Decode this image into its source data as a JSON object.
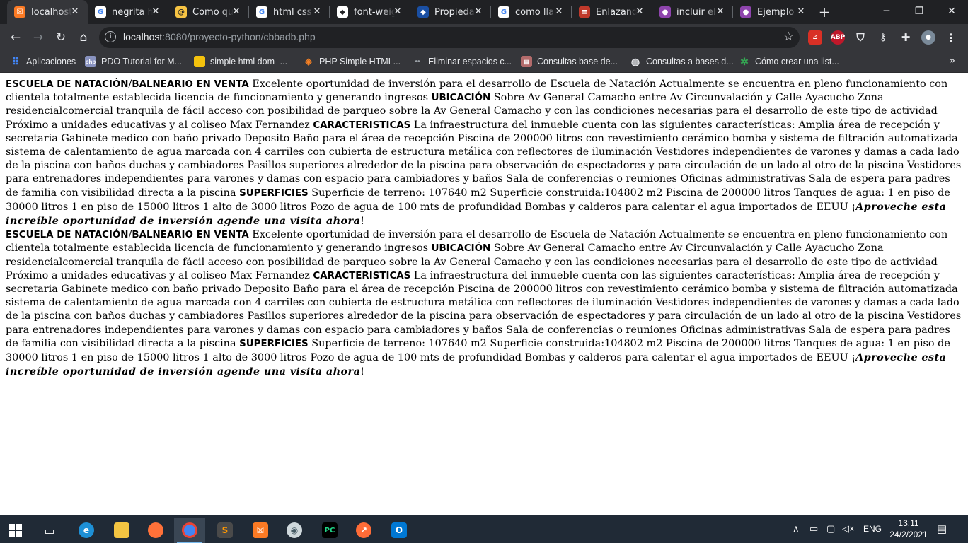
{
  "browser": {
    "tabs": [
      {
        "title": "localhost",
        "favicon": "xampp-icon",
        "color": "#fb7a24",
        "active": true
      },
      {
        "title": "negrita h",
        "favicon": "google-icon",
        "color": "#4285f4",
        "active": false
      },
      {
        "title": "Como qu",
        "favicon": "site-icon",
        "color": "#f6c343",
        "active": false
      },
      {
        "title": "html css",
        "favicon": "google-icon",
        "color": "#4285f4",
        "active": false
      },
      {
        "title": "font-weig",
        "favicon": "site-icon",
        "color": "#ffffff",
        "active": false
      },
      {
        "title": "Propieda",
        "favicon": "site-icon",
        "color": "#1a4fa3",
        "active": false
      },
      {
        "title": "como llar",
        "favicon": "google-icon",
        "color": "#4285f4",
        "active": false
      },
      {
        "title": "Enlazand",
        "favicon": "site-icon",
        "color": "#c0392b",
        "active": false
      },
      {
        "title": "incluir el",
        "favicon": "site-icon",
        "color": "#8e44ad",
        "active": false
      },
      {
        "title": "Ejemplo c",
        "favicon": "site-icon",
        "color": "#8e44ad",
        "active": false
      }
    ],
    "new_tab_glyph": "+",
    "window_controls": {
      "minimize": "─",
      "maximize": "❐",
      "close": "✕"
    },
    "url": {
      "host": "localhost",
      "rest": ":8080/proyecto-python/cbbadb.php"
    },
    "bookmarks": [
      {
        "label": "Aplicaciones",
        "icon": "apps-icon",
        "color": "#4285f4"
      },
      {
        "label": "PDO Tutorial for M...",
        "icon": "php-icon",
        "color": "#8892bf"
      },
      {
        "label": "simple html dom -...",
        "icon": "folder-icon",
        "color": "#f4c20d"
      },
      {
        "label": "PHP Simple HTML...",
        "icon": "site-icon",
        "color": "#f48024"
      },
      {
        "label": "Eliminar espacios c...",
        "icon": "site-icon",
        "color": "#3c4043"
      },
      {
        "label": "Consultas base de...",
        "icon": "site-icon",
        "color": "#b36b6b"
      },
      {
        "label": "Consultas a bases d...",
        "icon": "globe-icon",
        "color": "#e8eaed"
      },
      {
        "label": "Cómo crear una list...",
        "icon": "site-icon",
        "color": "#34a853"
      }
    ],
    "bookmarks_more": "»"
  },
  "page": {
    "listings": [
      {
        "heading1": "ESCUELA DE NATACIÓN",
        "slash": "/",
        "heading2": "BALNEARIO EN VENTA",
        "text1": " Excelente oportunidad de inversión para el desarrollo de Escuela de Natación Actualmente se encuentra en pleno funcionamiento con clientela totalmente establecida licencia de funcionamiento y generando ingresos ",
        "heading3": "UBICACIÓN",
        "text2": " Sobre Av General Camacho entre Av Circunvalación y Calle Ayacucho Zona residencialcomercial tranquila de fácil acceso con posibilidad de parqueo sobre la Av General Camacho y con las condiciones necesarias para el desarrollo de este tipo de actividad Próximo a unidades educativas y al coliseo Max Fernandez ",
        "heading4": "CARACTERISTICAS",
        "text3": " La infraestructura del inmueble cuenta con las siguientes características: Amplia área de recepción y secretaria Gabinete medico con baño privado Deposito Baño para el área de recepción Piscina de 200000 litros con revestimiento cerámico bomba y sistema de filtración automatizada sistema de calentamiento de agua marcada con 4 carriles con cubierta de estructura metálica con reflectores de iluminación Vestidores independientes de varones y damas a cada lado de la piscina con baños duchas y cambiadores Pasillos superiores alrededor de la piscina para observación de espectadores y para circulación de un lado al otro de la piscina Vestidores para entrenadores independientes para varones y damas con espacio para cambiadores y baños Sala de conferencias o reuniones Oficinas administrativas Sala de espera para padres de familia con visibilidad directa a la piscina ",
        "heading5": "SUPERFICIES",
        "text4": " Superficie de terreno: 107640 m2 Superficie construida:104802 m2 Piscina de 200000 litros Tanques de agua: 1 en piso de 30000 litros 1 en piso de 15000 litros 1 alto de 3000 litros Pozo de agua de 100 mts de profundidad Bombas y calderos para calentar el agua importados de EEUU ¡",
        "cta": "Aproveche esta increíble oportunidad de inversión agende una visita ahora",
        "end": "!"
      },
      {
        "heading1": "ESCUELA DE NATACIÓN",
        "slash": "/",
        "heading2": "BALNEARIO EN VENTA",
        "text1": " Excelente oportunidad de inversión para el desarrollo de Escuela de Natación Actualmente se encuentra en pleno funcionamiento con clientela totalmente establecida licencia de funcionamiento y generando ingresos ",
        "heading3": "UBICACIÓN",
        "text2": " Sobre Av General Camacho entre Av Circunvalación y Calle Ayacucho Zona residencialcomercial tranquila de fácil acceso con posibilidad de parqueo sobre la Av General Camacho y con las condiciones necesarias para el desarrollo de este tipo de actividad Próximo a unidades educativas y al coliseo Max Fernandez ",
        "heading4": "CARACTERISTICAS",
        "text3": " La infraestructura del inmueble cuenta con las siguientes características: Amplia área de recepción y secretaria Gabinete medico con baño privado Deposito Baño para el área de recepción Piscina de 200000 litros con revestimiento cerámico bomba y sistema de filtración automatizada sistema de calentamiento de agua marcada con 4 carriles con cubierta de estructura metálica con reflectores de iluminación Vestidores independientes de varones y damas a cada lado de la piscina con baños duchas y cambiadores Pasillos superiores alrededor de la piscina para observación de espectadores y para circulación de un lado al otro de la piscina Vestidores para entrenadores independientes para varones y damas con espacio para cambiadores y baños Sala de conferencias o reuniones Oficinas administrativas Sala de espera para padres de familia con visibilidad directa a la piscina ",
        "heading5": "SUPERFICIES",
        "text4": " Superficie de terreno: 107640 m2 Superficie construida:104802 m2 Piscina de 200000 litros Tanques de agua: 1 en piso de 30000 litros 1 en piso de 15000 litros 1 alto de 3000 litros Pozo de agua de 100 mts de profundidad Bombas y calderos para calentar el agua importados de EEUU ¡",
        "cta": "Aproveche esta increíble oportunidad de inversión agende una visita ahora",
        "end": "!"
      }
    ]
  },
  "taskbar": {
    "apps": [
      {
        "name": "start-icon",
        "color": "#ffffff"
      },
      {
        "name": "task-view-icon",
        "color": "#ffffff"
      },
      {
        "name": "edge-icon",
        "color": "#1e90d6"
      },
      {
        "name": "file-explorer-icon",
        "color": "#f4c542"
      },
      {
        "name": "firefox-icon",
        "color": "#ff7139"
      },
      {
        "name": "chrome-icon",
        "color": "#4285f4"
      },
      {
        "name": "sublime-text-icon",
        "color": "#ff9800"
      },
      {
        "name": "xampp-icon",
        "color": "#fb7a24"
      },
      {
        "name": "app-icon",
        "color": "#cfd8dc"
      },
      {
        "name": "pycharm-icon",
        "color": "#21d789"
      },
      {
        "name": "postman-icon",
        "color": "#ff6c37"
      },
      {
        "name": "outlook-icon",
        "color": "#0078d4"
      }
    ],
    "language": "ENG",
    "time": "13:11",
    "date": "24/2/2021"
  }
}
